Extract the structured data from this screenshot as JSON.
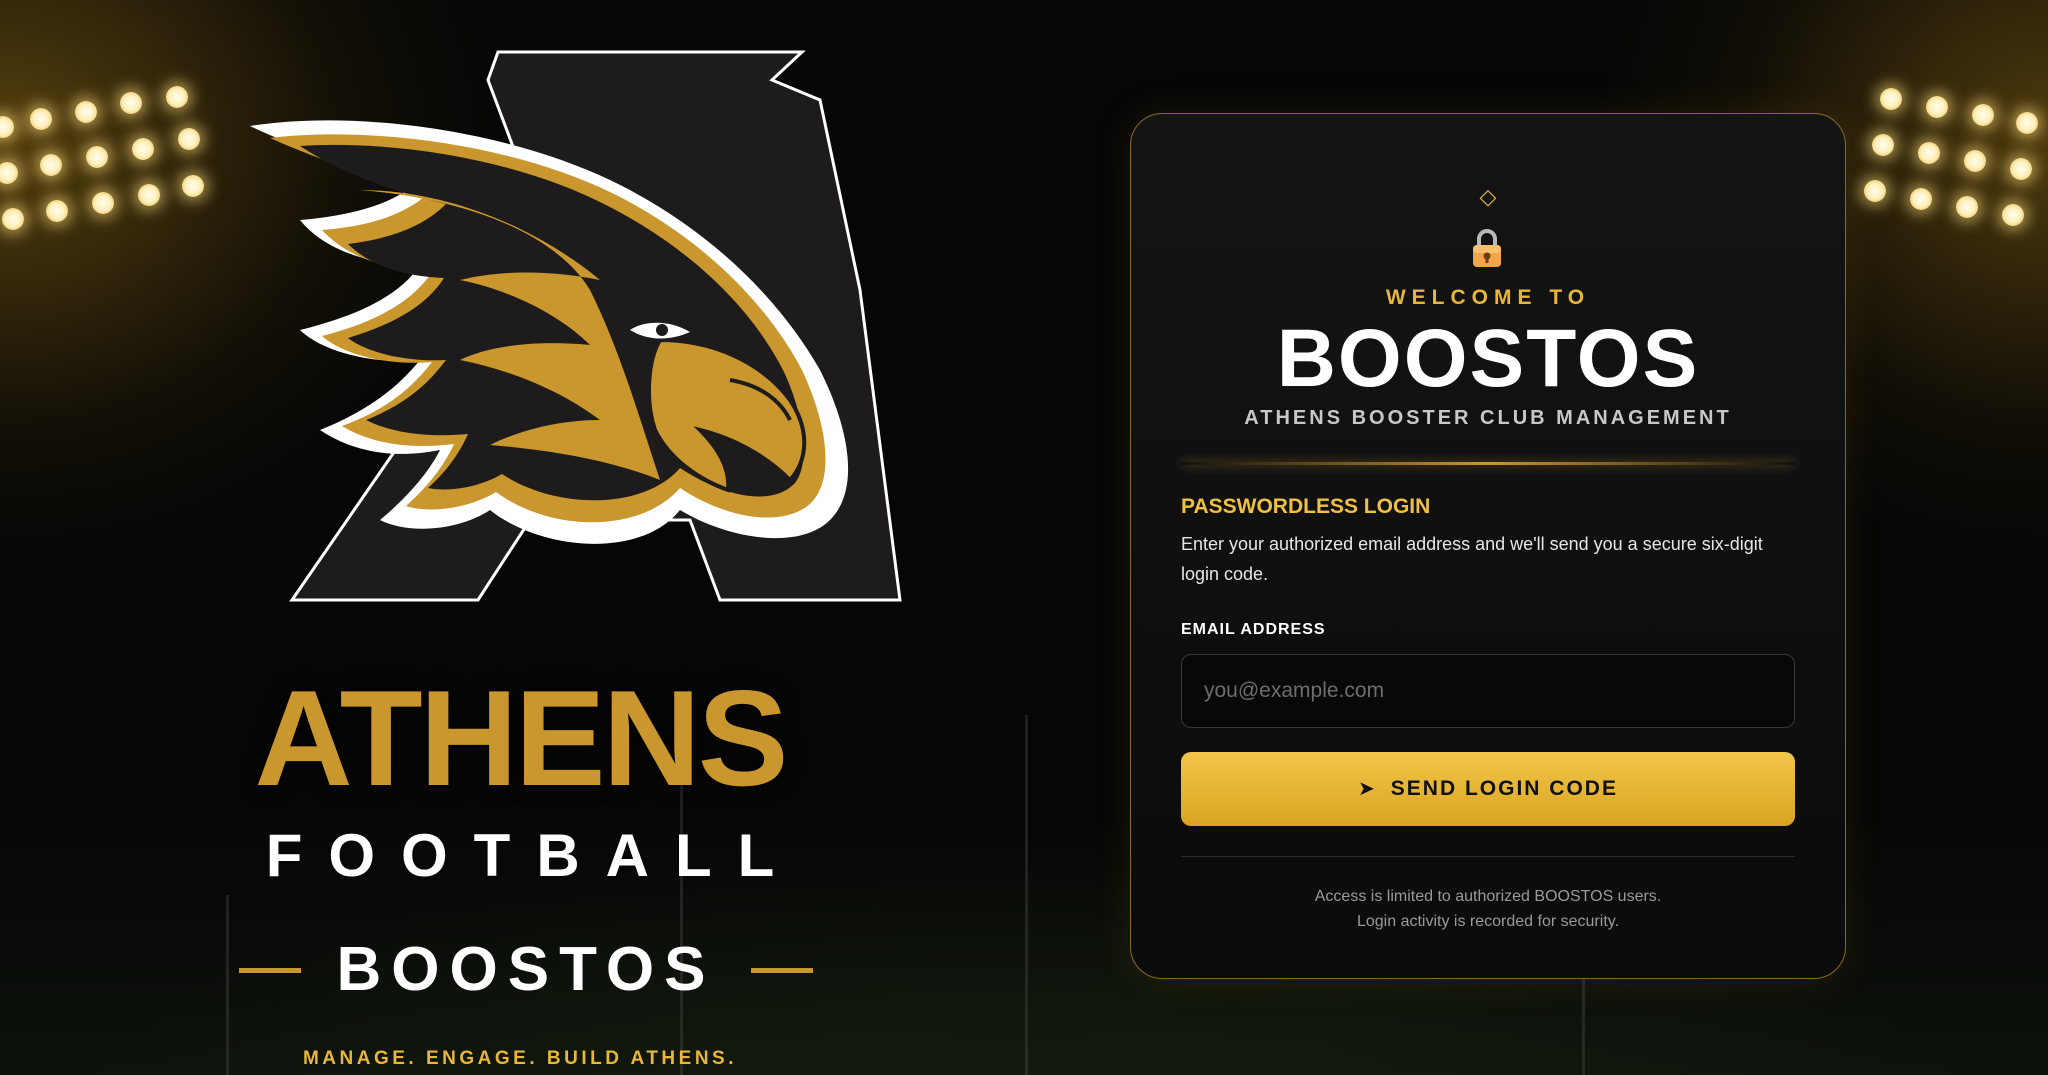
{
  "branding": {
    "team_name": "ATHENS",
    "sport": "FOOTBALL",
    "app_name": "BOOSTOS",
    "tagline": "MANAGE. ENGAGE. BUILD ATHENS.",
    "logo_letter": "A",
    "logo_icon": "hawk-icon",
    "colors": {
      "gold": "#c9972d",
      "accent": "#f0c040",
      "black": "#050505",
      "white": "#ffffff"
    }
  },
  "login_card": {
    "top_icon": "diamond-icon",
    "lock_icon": "lock-icon",
    "welcome": "WELCOME TO",
    "title": "BOOSTOS",
    "subtitle": "ATHENS BOOSTER CLUB MANAGEMENT",
    "section_heading": "PASSWORDLESS LOGIN",
    "description": "Enter your authorized email address and we'll send you a secure six-digit login code.",
    "email": {
      "label": "EMAIL ADDRESS",
      "placeholder": "you@example.com",
      "value": ""
    },
    "submit": {
      "icon": "send-icon",
      "label": "SEND LOGIN CODE"
    },
    "footer": {
      "line1": "Access is limited to authorized BOOSTOS users.",
      "line2": "Login activity is recorded for security."
    }
  }
}
